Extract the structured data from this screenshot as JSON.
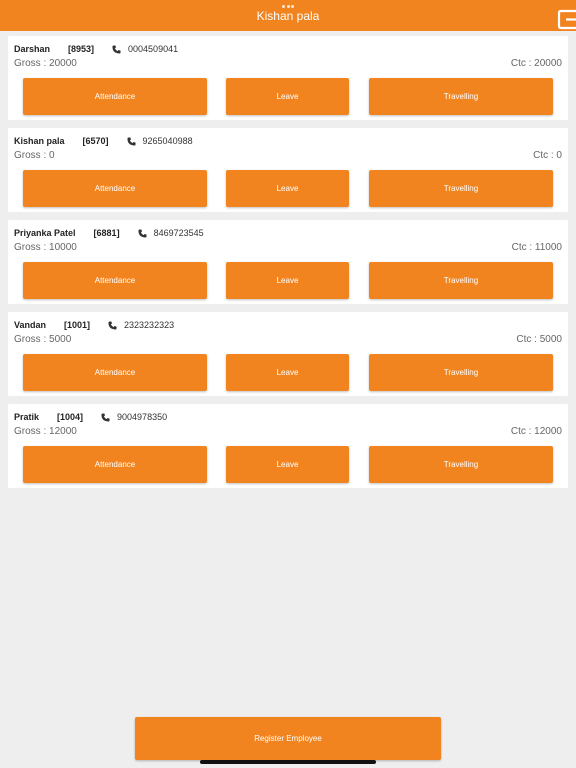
{
  "header": {
    "title": "Kishan pala"
  },
  "colors": {
    "accent": "#f28420",
    "background": "#eeeeee",
    "card": "#ffffff"
  },
  "icons": {
    "logout": "logout-icon",
    "phone": "phone-icon"
  },
  "employees": [
    {
      "name": "Darshan",
      "code": "[8953]",
      "phone": "0004509041",
      "gross": "Gross : 20000",
      "ctc": "Ctc : 20000",
      "attendance": "Attendance",
      "leave": "Leave",
      "travelling": "Travelling"
    },
    {
      "name": "Kishan pala",
      "code": "[6570]",
      "phone": "9265040988",
      "gross": "Gross : 0",
      "ctc": "Ctc : 0",
      "attendance": "Attendance",
      "leave": "Leave",
      "travelling": "Travelling"
    },
    {
      "name": "Priyanka Patel",
      "code": "[6881]",
      "phone": "8469723545",
      "gross": "Gross : 10000",
      "ctc": "Ctc : 11000",
      "attendance": "Attendance",
      "leave": "Leave",
      "travelling": "Travelling"
    },
    {
      "name": "Vandan",
      "code": "[1001]",
      "phone": "2323232323",
      "gross": "Gross : 5000",
      "ctc": "Ctc : 5000",
      "attendance": "Attendance",
      "leave": "Leave",
      "travelling": "Travelling"
    },
    {
      "name": "Pratik",
      "code": "[1004]",
      "phone": "9004978350",
      "gross": "Gross : 12000",
      "ctc": "Ctc : 12000",
      "attendance": "Attendance",
      "leave": "Leave",
      "travelling": "Travelling"
    }
  ],
  "footer": {
    "register_label": "Register Employee"
  }
}
